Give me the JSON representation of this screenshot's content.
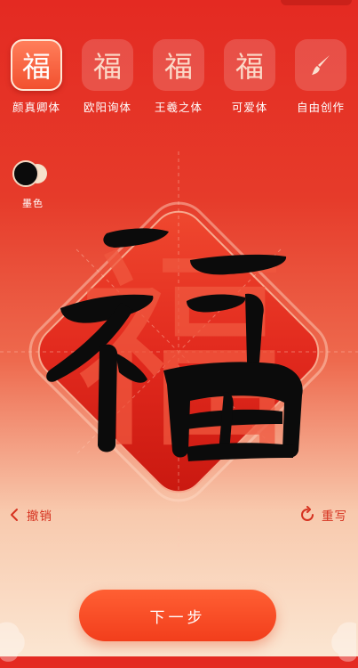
{
  "font_styles": [
    {
      "glyph": "福",
      "label": "颜真卿体",
      "selected": true
    },
    {
      "glyph": "福",
      "label": "欧阳询体",
      "selected": false
    },
    {
      "glyph": "福",
      "label": "王羲之体",
      "selected": false
    },
    {
      "glyph": "福",
      "label": "可爱体",
      "selected": false
    },
    {
      "glyph": "brush-icon",
      "label": "自由创作",
      "selected": false
    }
  ],
  "color_picker": {
    "label": "墨色",
    "selected": "#0b0b0b",
    "options": [
      "#0b0b0b",
      "#f6e2cb"
    ]
  },
  "canvas": {
    "template_char": "福",
    "ink_color": "#0b0b0b",
    "paper_color": "#e0261d"
  },
  "actions": {
    "undo_label": "撤销",
    "redo_label": "重写",
    "next_label": "下一步"
  },
  "colors": {
    "accent": "#f23e1c",
    "action_text": "#d6311f"
  }
}
